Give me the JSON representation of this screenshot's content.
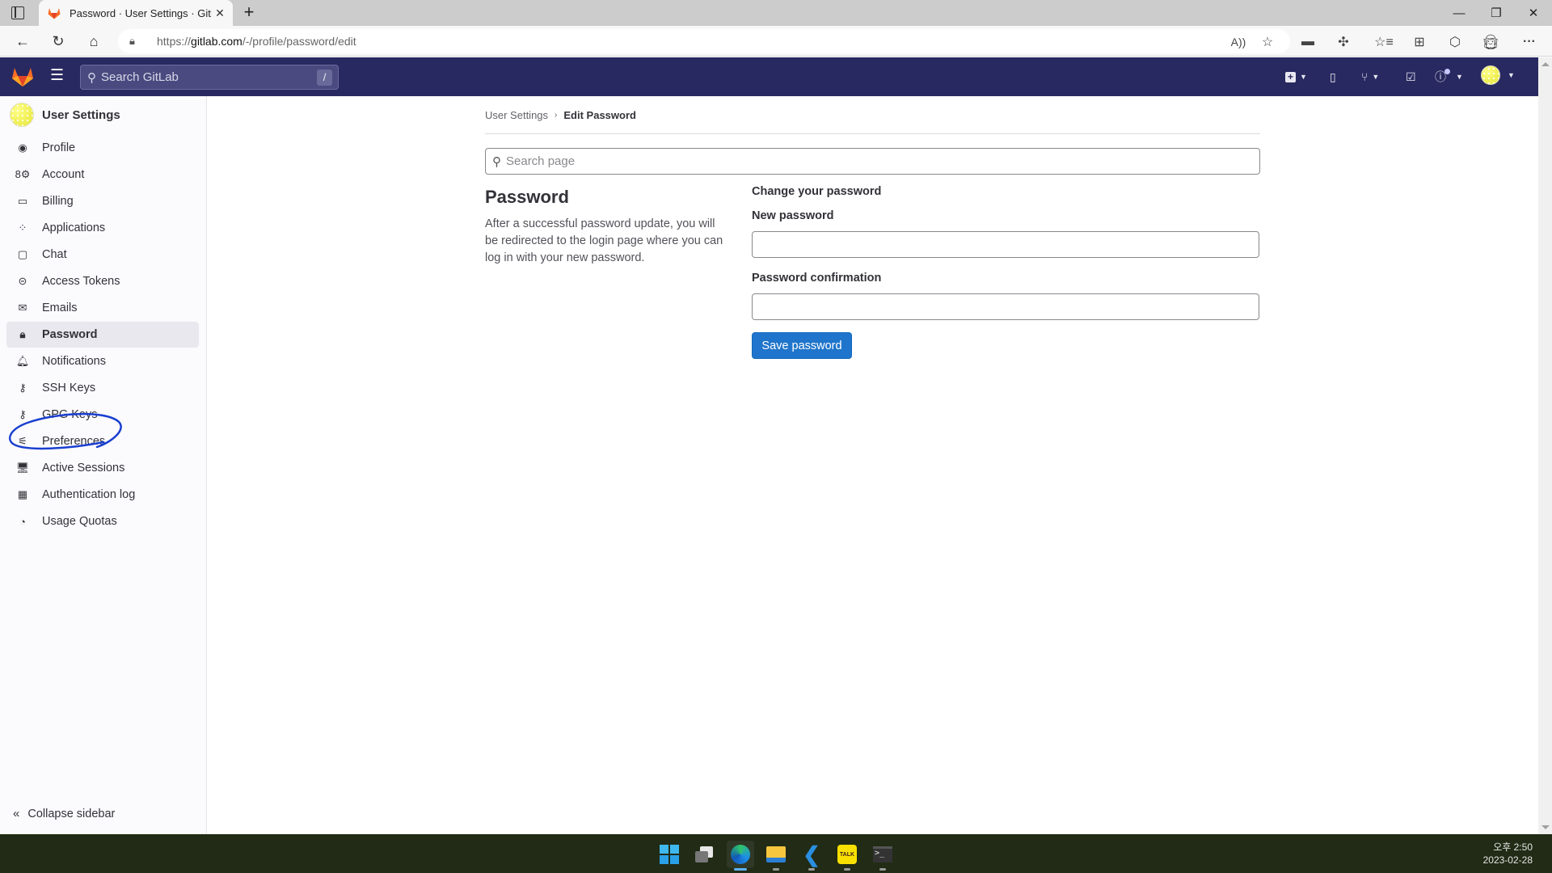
{
  "browser": {
    "tab_title": "Password · User Settings · GitLab",
    "url_prefix": "https://",
    "url_host": "gitlab.com",
    "url_path": "/-/profile/password/edit",
    "icons": [
      "sidebar-toggle-icon",
      "back-icon",
      "refresh-icon",
      "home-icon",
      "lock-icon",
      "read-aloud-icon",
      "add-favorite-icon",
      "media-icon",
      "extensions-icon",
      "favorites-icon",
      "collections-icon",
      "browser-essentials-icon",
      "profile-icon",
      "more-icon"
    ]
  },
  "gitlab_nav": {
    "search_placeholder": "Search GitLab",
    "search_shortcut": "/"
  },
  "sidebar": {
    "title": "User Settings",
    "items": [
      {
        "label": "Profile",
        "icon": "profile-icon",
        "active": false
      },
      {
        "label": "Account",
        "icon": "account-icon",
        "active": false
      },
      {
        "label": "Billing",
        "icon": "credit-card-icon",
        "active": false
      },
      {
        "label": "Applications",
        "icon": "applications-icon",
        "active": false
      },
      {
        "label": "Chat",
        "icon": "comment-icon",
        "active": false
      },
      {
        "label": "Access Tokens",
        "icon": "token-icon",
        "active": false
      },
      {
        "label": "Emails",
        "icon": "mail-icon",
        "active": false
      },
      {
        "label": "Password",
        "icon": "lock-icon",
        "active": true
      },
      {
        "label": "Notifications",
        "icon": "bell-icon",
        "active": false
      },
      {
        "label": "SSH Keys",
        "icon": "key-icon",
        "active": false
      },
      {
        "label": "GPG Keys",
        "icon": "key-icon",
        "active": false
      },
      {
        "label": "Preferences",
        "icon": "preferences-icon",
        "active": false
      },
      {
        "label": "Active Sessions",
        "icon": "monitor-icon",
        "active": false
      },
      {
        "label": "Authentication log",
        "icon": "log-icon",
        "active": false
      },
      {
        "label": "Usage Quotas",
        "icon": "quota-icon",
        "active": false
      }
    ],
    "collapse_label": "Collapse sidebar"
  },
  "breadcrumb": {
    "parent": "User Settings",
    "current": "Edit Password"
  },
  "page_search": {
    "placeholder": "Search page",
    "value": ""
  },
  "section": {
    "title": "Password",
    "description": "After a successful password update, you will be redirected to the login page where you can log in with your new password."
  },
  "form": {
    "heading": "Change your password",
    "new_password_label": "New password",
    "new_password_value": "",
    "confirm_label": "Password confirmation",
    "confirm_value": "",
    "save_label": "Save password"
  },
  "taskbar": {
    "apps": [
      "windows-start-icon",
      "task-view-icon",
      "edge-icon",
      "file-explorer-icon",
      "vscode-icon",
      "kakaotalk-icon",
      "terminal-icon"
    ],
    "time": "오후 2:50",
    "date": "2023-02-28"
  },
  "colors": {
    "nav_bg": "#292961",
    "primary_button": "#1f75cb",
    "annotation_stroke": "#1a3fd0"
  }
}
